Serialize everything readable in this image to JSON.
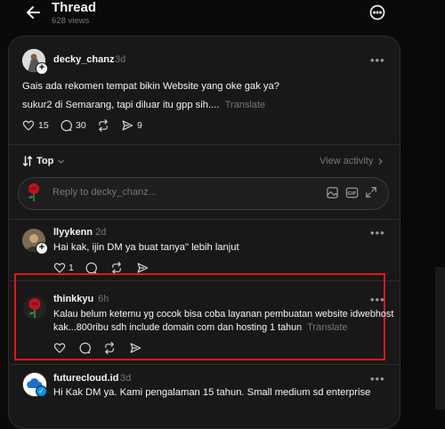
{
  "header": {
    "title": "Thread",
    "views": "628 views"
  },
  "original_post": {
    "username": "decky_chanz",
    "time": "3d",
    "line1": "Gais ada rekomen tempat bikin Website yang oke gak ya?",
    "line2": "sukur2 di Semarang, tapi diluar itu gpp sih....",
    "translate": "Translate",
    "likes": "15",
    "comments": "30",
    "shares": "9"
  },
  "sort": {
    "label": "Top",
    "view_activity": "View activity"
  },
  "reply_box": {
    "placeholder": "Reply to decky_chanz..."
  },
  "replies": [
    {
      "username": "llyykenn",
      "time": "2d",
      "text": "Hai kak, ijin DM ya buat tanya\" lebih lanjut",
      "likes": "1"
    },
    {
      "username": "thinkkyu",
      "time": "6h",
      "text1": "Kalau belum ketemu yg cocok bisa coba layanan pembuatan website idwebhost",
      "text2": "kak...800ribu sdh include domain com dan hosting 1 tahun",
      "translate": "Translate"
    },
    {
      "username": "futurecloud.id",
      "time": "3d",
      "text": "Hi Kak DM ya. Kami pengalaman 15 tahun. Small medium sd enterprise"
    }
  ],
  "colors": {
    "background": "#0a0a0a",
    "card": "#181818",
    "highlight_border": "#e0161b",
    "verified": "#0095f6",
    "muted_text": "#777777"
  }
}
